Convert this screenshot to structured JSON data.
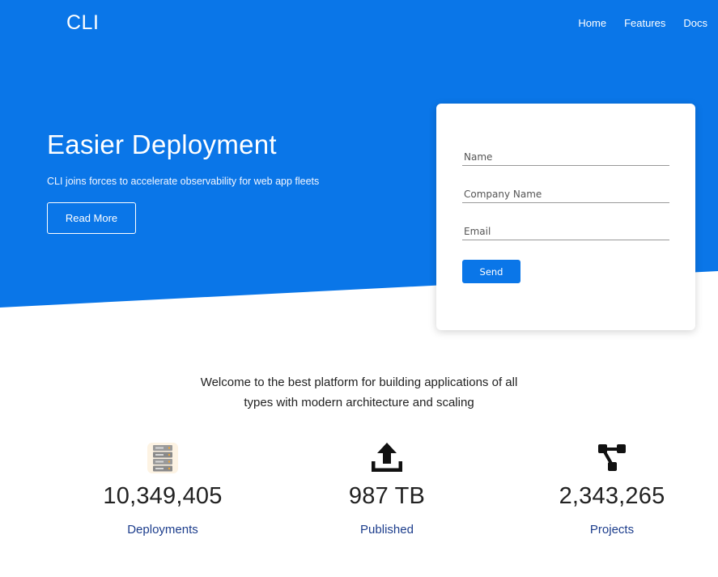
{
  "brand": "CLI",
  "nav": {
    "home": "Home",
    "features": "Features",
    "docs": "Docs"
  },
  "hero": {
    "title": "Easier Deployment",
    "subtitle": "CLI joins forces to accelerate observability for web app fleets",
    "cta": "Read More"
  },
  "form": {
    "name_placeholder": "Name",
    "company_placeholder": "Company Name",
    "email_placeholder": "Email",
    "submit": "Send"
  },
  "welcome": {
    "line1": "Welcome to the best platform for building applications of all",
    "line2": "types with modern architecture and scaling"
  },
  "stats": [
    {
      "icon": "server-rack-icon",
      "value": "10,349,405",
      "label": "Deployments"
    },
    {
      "icon": "upload-icon",
      "value": "987 TB",
      "label": "Published"
    },
    {
      "icon": "flow-nodes-icon",
      "value": "2,343,265",
      "label": "Projects"
    }
  ],
  "colors": {
    "primary": "#0a76e8",
    "stat_label": "#1c3d8c"
  }
}
